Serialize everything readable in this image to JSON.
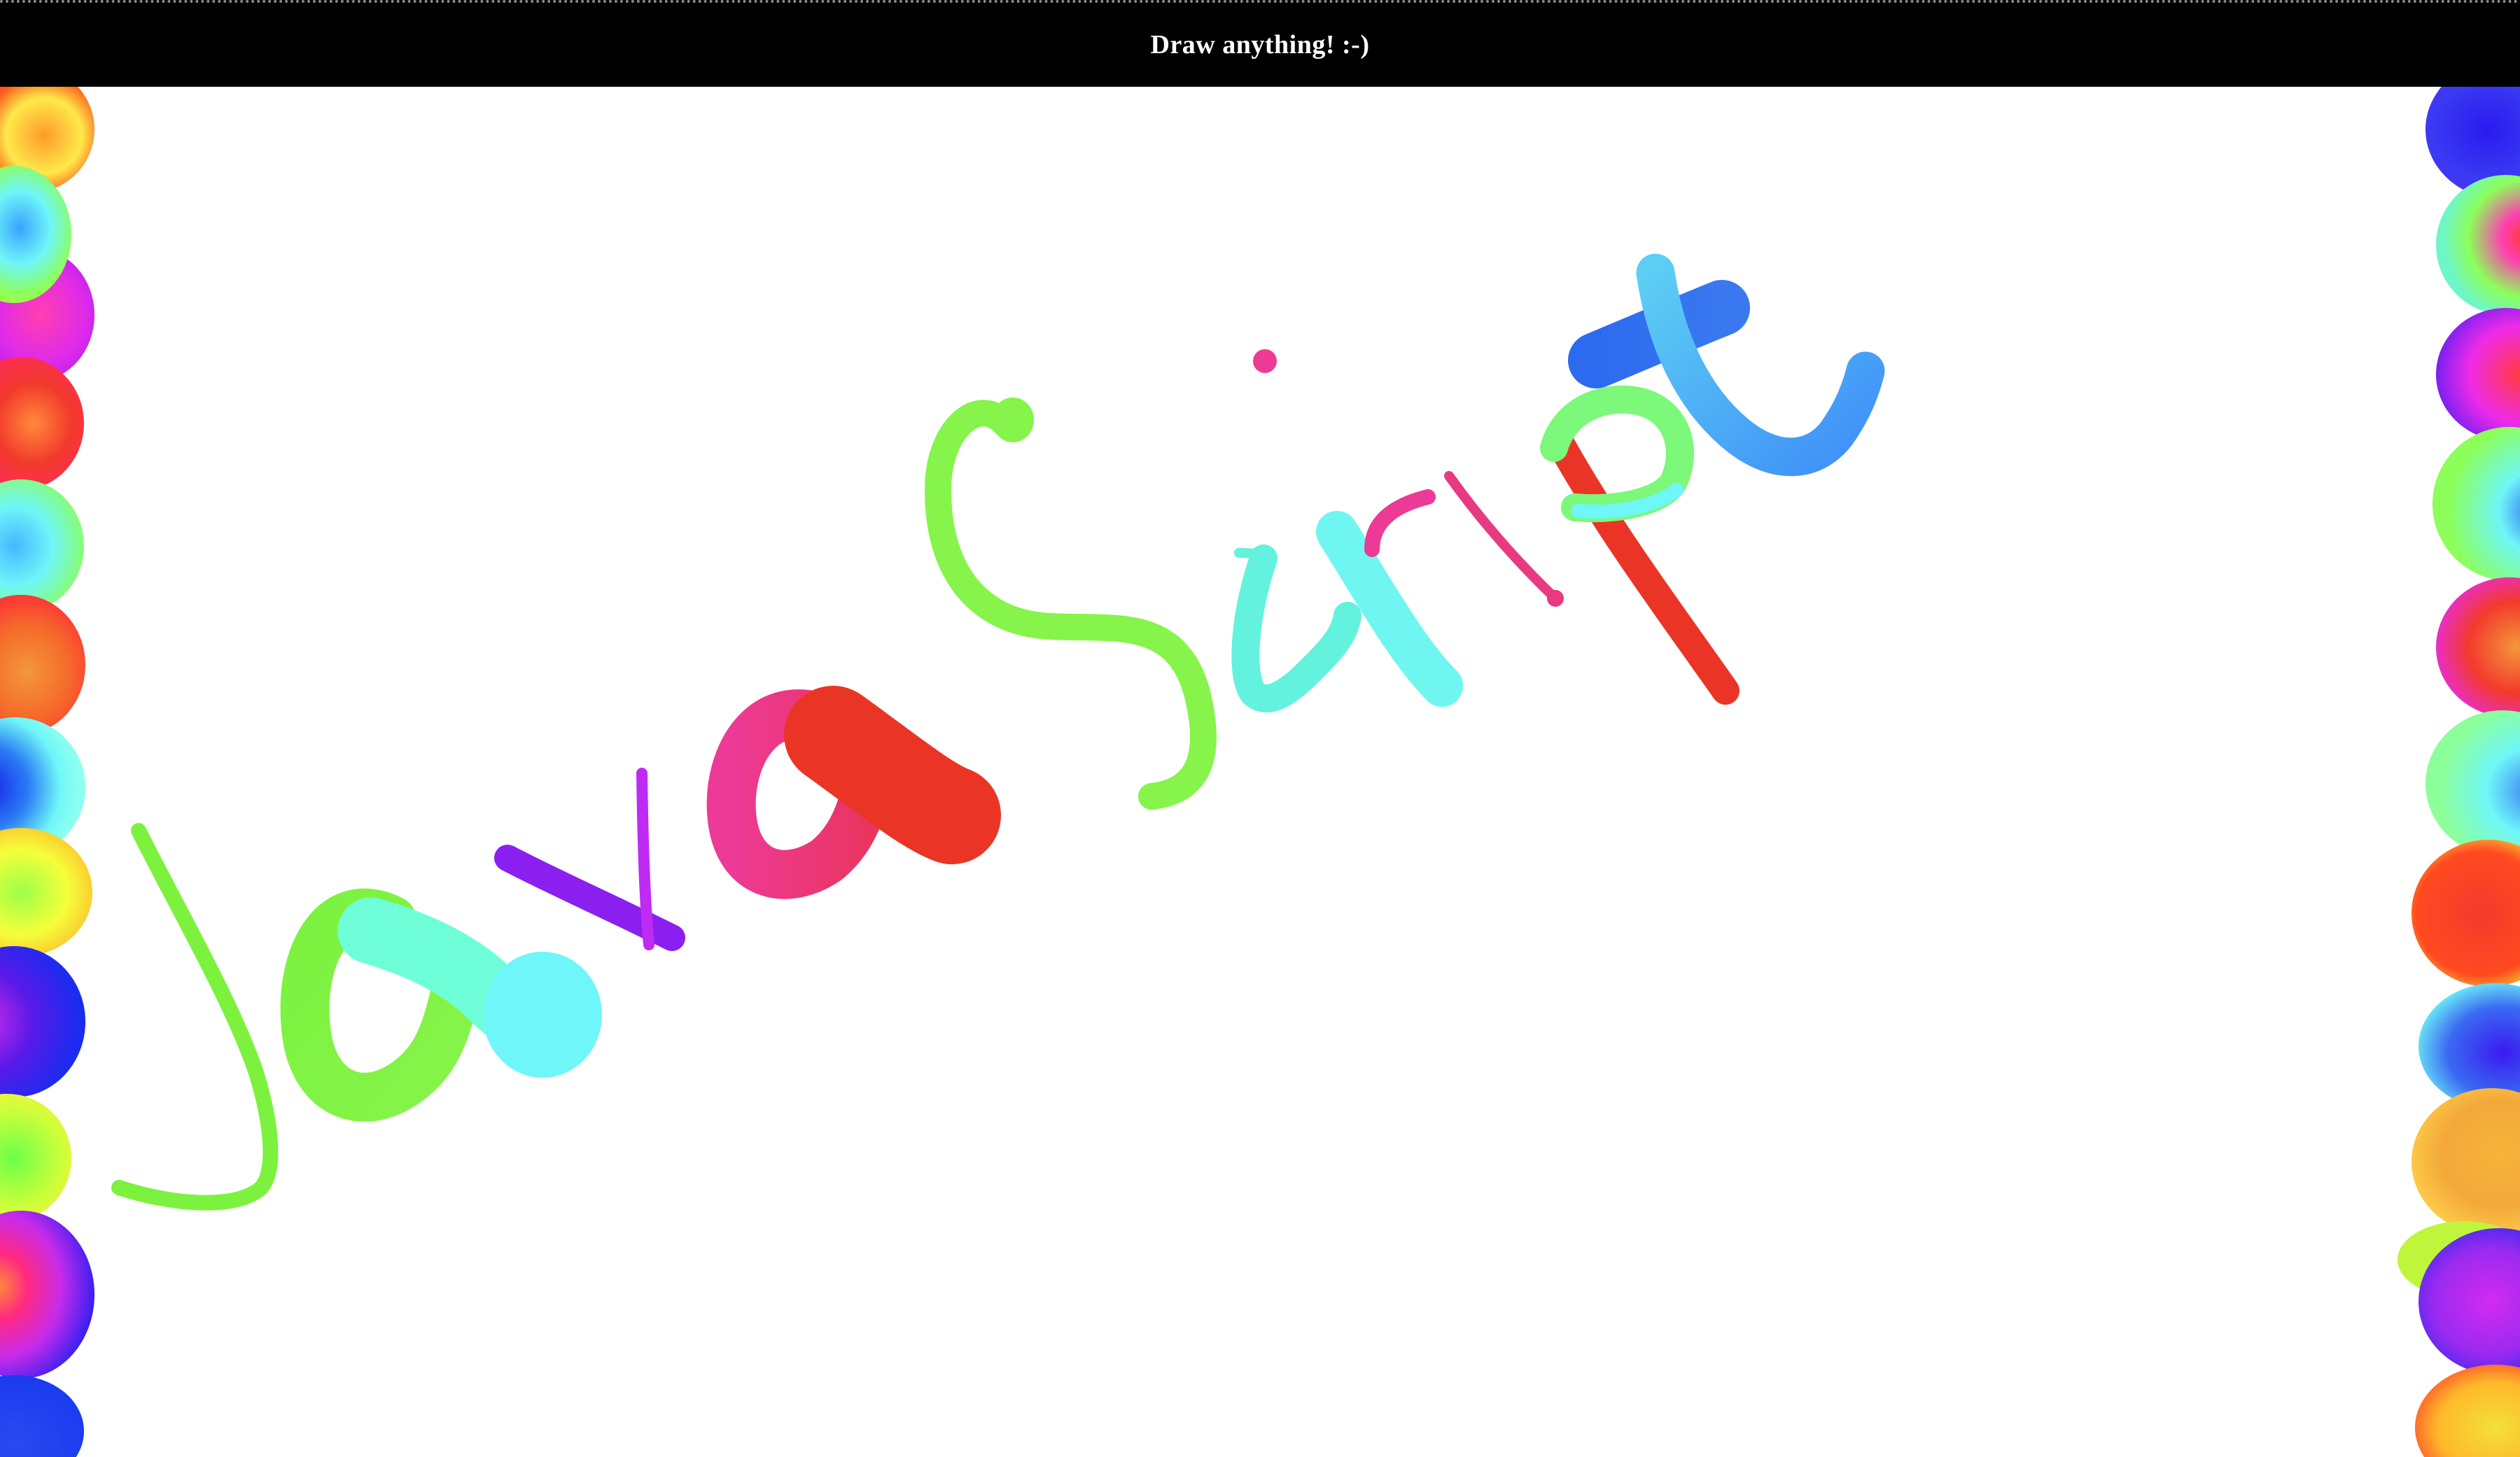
{
  "header": {
    "title": "Draw anything! :-)"
  },
  "canvas": {
    "background": "#ffffff",
    "drawing_description_colors": {
      "lime": "#7CF23F",
      "mint": "#6FFFD8",
      "aqua": "#6FF6F8",
      "teal": "#63F2DE",
      "purple": "#8B1FF0",
      "violet": "#C02BF4",
      "pink": "#EC3A96",
      "red": "#EA3526",
      "blue": "#2C6AF0",
      "sky": "#4AA7F8",
      "cyan": "#5CEAF4"
    }
  }
}
